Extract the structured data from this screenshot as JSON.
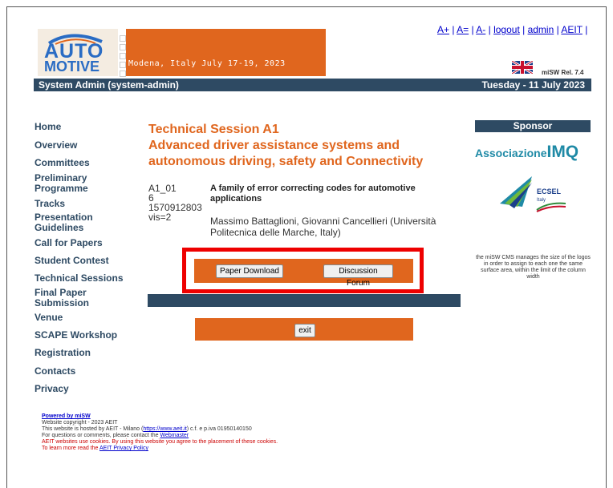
{
  "top_links": [
    {
      "label": "A+"
    },
    {
      "label": "A="
    },
    {
      "label": "A-"
    },
    {
      "label": "logout"
    },
    {
      "label": "admin"
    },
    {
      "label": "AEIT"
    }
  ],
  "banner": {
    "logo_line1": "AUTO",
    "logo_line2": "MOTIVE",
    "tagline": "Modena, Italy  July 17-19, 2023"
  },
  "release": "miSW Rel. 7.4",
  "header": {
    "user": "System Admin (system-admin)",
    "date": "Tuesday - 11 July 2023"
  },
  "nav": [
    "Home",
    "Overview",
    "Committees",
    "Preliminary Programme",
    "Tracks",
    "Presentation Guidelines",
    "Call for Papers",
    "Student Contest",
    "Technical Sessions",
    "Final Paper Submission",
    "Venue",
    "SCAPE Workshop",
    "Registration",
    "Contacts",
    "Privacy"
  ],
  "session": {
    "title_line1": "Technical Session A1",
    "title_line2": "Advanced driver assistance systems and",
    "title_line3": "autonomous driving, safety and Connectivity"
  },
  "paper": {
    "code": "A1_01",
    "number": "6",
    "id": "1570912803",
    "vis": "vis=2",
    "title": "A family of error correcting codes for automotive applications",
    "authors": "Massimo Battaglioni, Giovanni Cancellieri (Università Politecnica delle Marche, Italy)"
  },
  "buttons": {
    "download": "Paper Download",
    "forum": "Discussion Forum",
    "exit": "exit"
  },
  "sponsor": {
    "heading": "Sponsor",
    "imq_text": "Associazione",
    "imq_bold": "IMQ",
    "ecsel": "ECSEL",
    "ecsel_sub": "Italy",
    "note": "the miSW CMS manages the size of the logos in order to assign to each one the same surface area, within the limit of the column width"
  },
  "footer": {
    "powered": "Powered by miSW",
    "copyright": "Website copyright - 2023 AEIT",
    "hosted_pre": "This website is hosted by AEIT - Milano (",
    "hosted_link": "https://www.aeit.it",
    "hosted_post": ") c.f. e p.iva 01950140150",
    "questions_pre": "For questions or comments, please contact the ",
    "questions_link": "Webmaster",
    "cookies": "AEIT websites use cookies. By using this website you agree to the placement of these cookies.",
    "learn_pre": "To learn more read the ",
    "learn_link": "AEIT Privacy Policy"
  },
  "colors": {
    "accent_orange": "#e0661e",
    "navy": "#2e4a63",
    "highlight_red": "#ee0000"
  }
}
